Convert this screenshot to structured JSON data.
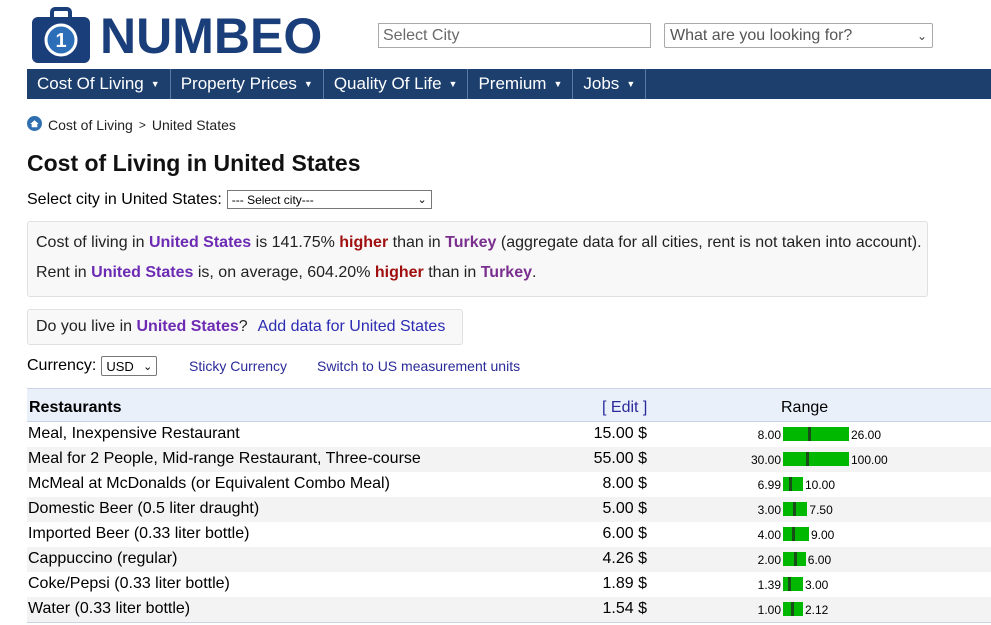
{
  "header": {
    "logo_text": "NUMBEO",
    "search_placeholder": "Select City",
    "looking_for": "What are you looking for?"
  },
  "nav": [
    {
      "label": "Cost Of Living"
    },
    {
      "label": "Property Prices"
    },
    {
      "label": "Quality Of Life"
    },
    {
      "label": "Premium"
    },
    {
      "label": "Jobs"
    }
  ],
  "breadcrumb": {
    "home": "Cost of Living",
    "separator": ">",
    "current": "United States"
  },
  "page": {
    "title": "Cost of Living in United States",
    "select_city_label": "Select city in United States:",
    "select_city_value": "--- Select city---"
  },
  "summary": {
    "line1": {
      "prefix": "Cost of living in",
      "country": "United States",
      "mid": "is 141.75%",
      "higher": "higher",
      "than": "than in",
      "other": "Turkey",
      "suffix": "(aggregate data for all cities, rent is not taken into account)."
    },
    "line2": {
      "prefix": "Rent in",
      "country": "United States",
      "mid": "is, on average, 604.20%",
      "higher": "higher",
      "than": "than in",
      "other": "Turkey",
      "suffix": "."
    }
  },
  "live": {
    "prefix": "Do you live in",
    "country": "United States",
    "q": "?",
    "add_link": "Add data for United States"
  },
  "currency": {
    "label": "Currency:",
    "value": "USD",
    "sticky": "Sticky Currency",
    "switch_units": "Switch to US measurement units"
  },
  "table": {
    "section": "Restaurants",
    "edit": "[ Edit ]",
    "range": "Range",
    "rows": [
      {
        "item": "Meal, Inexpensive Restaurant",
        "price": "15.00 $",
        "min": "8.00",
        "max": "26.00"
      },
      {
        "item": "Meal for 2 People, Mid-range Restaurant, Three-course",
        "price": "55.00 $",
        "min": "30.00",
        "max": "100.00"
      },
      {
        "item": "McMeal at McDonalds (or Equivalent Combo Meal)",
        "price": "8.00 $",
        "min": "6.99",
        "max": "10.00"
      },
      {
        "item": "Domestic Beer (0.5 liter draught)",
        "price": "5.00 $",
        "min": "3.00",
        "max": "7.50"
      },
      {
        "item": "Imported Beer (0.33 liter bottle)",
        "price": "6.00 $",
        "min": "4.00",
        "max": "9.00"
      },
      {
        "item": "Cappuccino (regular)",
        "price": "4.26 $",
        "min": "2.00",
        "max": "6.00"
      },
      {
        "item": "Coke/Pepsi (0.33 liter bottle)",
        "price": "1.89 $",
        "min": "1.39",
        "max": "3.00"
      },
      {
        "item": "Water (0.33 liter bottle)",
        "price": "1.54 $",
        "min": "1.00",
        "max": "2.12"
      }
    ]
  },
  "colors": {
    "nav_bg": "#1c3f6e",
    "bar_green": "#00b800",
    "link_purple": "#6d2bb3",
    "higher_red": "#a01010"
  }
}
